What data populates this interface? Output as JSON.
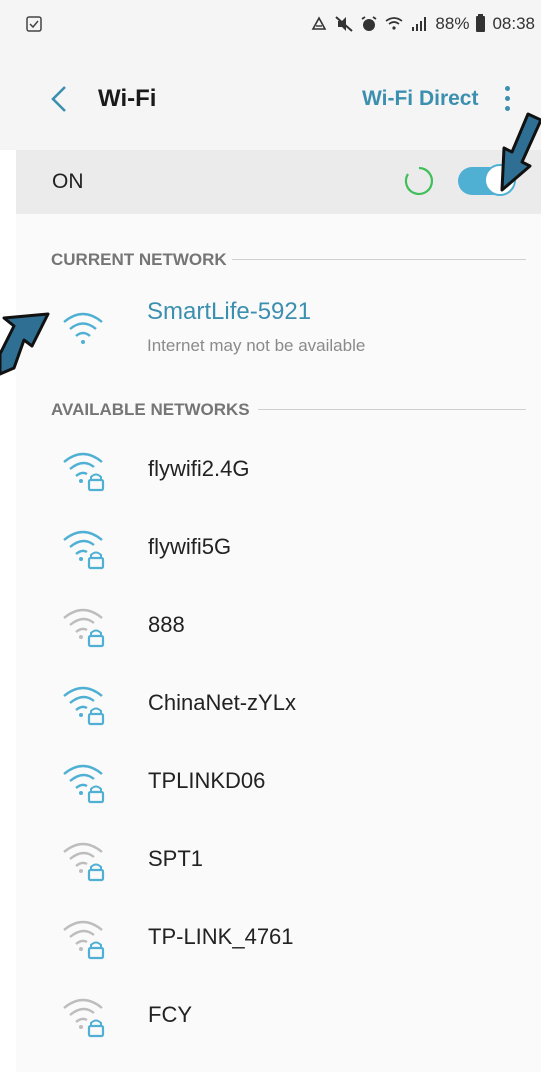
{
  "status_bar": {
    "battery_percent": "88%",
    "time": "08:38"
  },
  "app_bar": {
    "title": "Wi-Fi",
    "wifi_direct_label": "Wi-Fi Direct"
  },
  "wifi_toggle": {
    "label": "ON",
    "state": "on"
  },
  "current_network": {
    "header": "CURRENT NETWORK",
    "name": "SmartLife-5921",
    "status": "Internet may not be available"
  },
  "available_networks": {
    "header": "AVAILABLE NETWORKS",
    "items": [
      {
        "name": "flywifi2.4G",
        "signal": "strong",
        "locked": true
      },
      {
        "name": "flywifi5G",
        "signal": "strong",
        "locked": true
      },
      {
        "name": "888",
        "signal": "weak",
        "locked": true
      },
      {
        "name": "ChinaNet-zYLx",
        "signal": "strong",
        "locked": true
      },
      {
        "name": "TPLINKD06",
        "signal": "strong",
        "locked": true
      },
      {
        "name": "SPT1",
        "signal": "weak",
        "locked": true
      },
      {
        "name": "TP-LINK_4761",
        "signal": "weak",
        "locked": true
      },
      {
        "name": "FCY",
        "signal": "weak",
        "locked": true
      }
    ]
  },
  "colors": {
    "accent": "#3d8fb0",
    "toggle": "#4fb0d4",
    "wifi_strong": "#4fb0d4",
    "wifi_weak": "#bdbdbd",
    "arrow": "#2f6f93"
  }
}
